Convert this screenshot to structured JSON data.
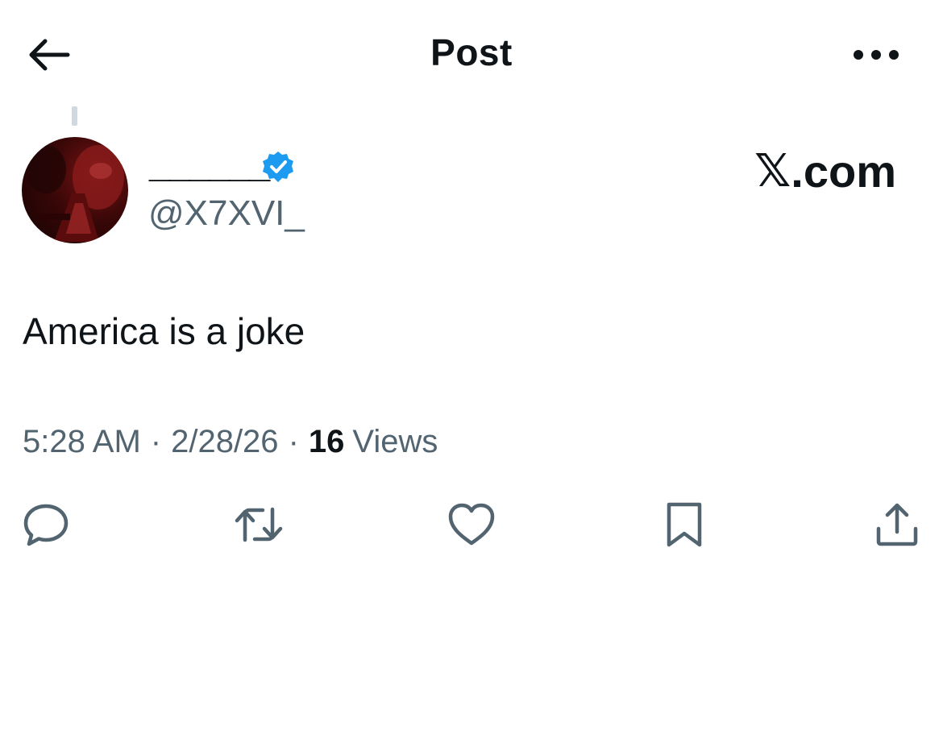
{
  "header": {
    "title": "Post",
    "back_icon": "back-arrow-icon",
    "more_icon": "more-options-icon"
  },
  "author": {
    "display_name": "______",
    "handle": "@X7XVI_",
    "verified": true,
    "verified_color": "#1d9bf0"
  },
  "watermark": {
    "logo": "𝕏",
    "suffix": ".com"
  },
  "post": {
    "text": "America is a joke",
    "time": "5:28 AM",
    "date": "2/28/26",
    "views_count": "16",
    "views_label": "Views"
  },
  "actions": [
    {
      "name": "reply",
      "icon": "reply-icon"
    },
    {
      "name": "repost",
      "icon": "repost-icon"
    },
    {
      "name": "like",
      "icon": "heart-icon"
    },
    {
      "name": "bookmark",
      "icon": "bookmark-icon"
    },
    {
      "name": "share",
      "icon": "share-icon"
    }
  ],
  "colors": {
    "text_primary": "#0f1419",
    "text_secondary": "#536471",
    "icon": "#536471"
  }
}
